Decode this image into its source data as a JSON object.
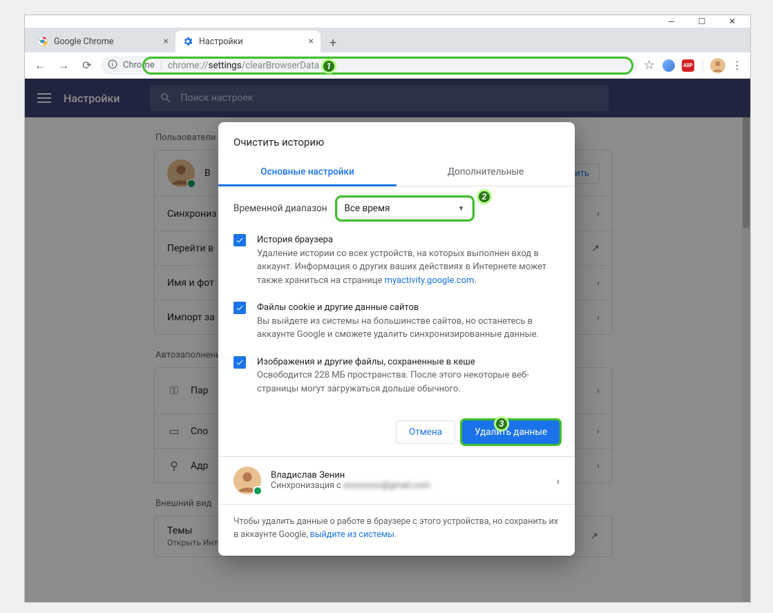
{
  "window": {
    "tabs": [
      {
        "title": "Google Chrome"
      },
      {
        "title": "Настройки"
      }
    ]
  },
  "toolbar": {
    "security_label": "Chrome",
    "url_prefix": "chrome://",
    "url_mid": "settings",
    "url_suffix": "/clearBrowserData",
    "abp": "ABP"
  },
  "page": {
    "title": "Настройки",
    "search_placeholder": "Поиск настроек",
    "sections": {
      "users": "Пользователи",
      "autofill": "Автозаполнение",
      "appearance": "Внешний вид"
    },
    "rows": {
      "profile_name_initial": "В",
      "enable": "ключить",
      "sync": "Синхрониз",
      "goto": "Перейти в",
      "name_photo": "Имя и фот",
      "import": "Импорт за",
      "passwords": "Пар",
      "payment": "Спо",
      "addresses": "Адр",
      "themes": "Темы",
      "themes_sub": "Открыть Интернет-магазин Chrome"
    }
  },
  "modal": {
    "title": "Очистить историю",
    "tab_basic": "Основные настройки",
    "tab_advanced": "Дополнительные",
    "time_label": "Временной диапазон",
    "time_value": "Все время",
    "items": [
      {
        "title": "История браузера",
        "desc_pre": "Удаление истории со всех устройств, на которых выполнен вход в аккаунт. Информация о других ваших действиях в Интернете может также храниться на странице ",
        "link": "myactivity.google.com",
        "desc_post": "."
      },
      {
        "title": "Файлы cookie и другие данные сайтов",
        "desc": "Вы выйдете из системы на большинстве сайтов, но останетесь в аккаунте Google и сможете удалить синхронизированные данные."
      },
      {
        "title": "Изображения и другие файлы, сохраненные в кеше",
        "desc": "Освободится 228 МБ пространства. После этого некоторые веб-страницы могут загружаться дольше обычного."
      }
    ],
    "cancel": "Отмена",
    "confirm": "Удалить данные",
    "user": {
      "name": "Владислав Зенин",
      "sync_prefix": "Синхронизация с ",
      "email_blur": "xxxxxxxxx@gmail.com"
    },
    "footer_pre": "Чтобы удалить данные о работе в браузере с этого устройства, но сохранить их в аккаунте Google, ",
    "footer_link": "выйдите из системы",
    "footer_post": "."
  },
  "annotations": {
    "a1": "1",
    "a2": "2",
    "a3": "3"
  }
}
